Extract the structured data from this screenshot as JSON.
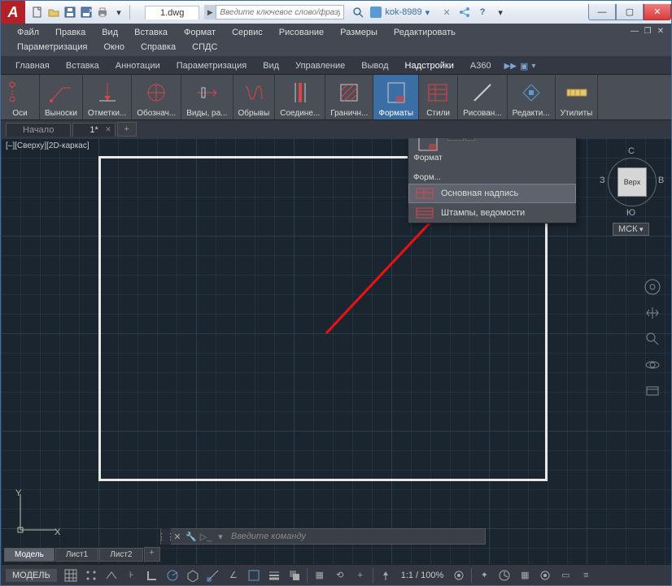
{
  "titlebar": {
    "app_initial": "A",
    "doc_title": "1.dwg",
    "search_placeholder": "Введите ключевое слово/фразу",
    "signin_user": "kok-8989"
  },
  "menu": {
    "items": [
      "Файл",
      "Правка",
      "Вид",
      "Вставка",
      "Формат",
      "Сервис",
      "Рисование",
      "Размеры",
      "Редактировать",
      "Параметризация",
      "Окно",
      "Справка",
      "СПДС"
    ]
  },
  "ribbon_tabs": [
    "Главная",
    "Вставка",
    "Аннотации",
    "Параметризация",
    "Вид",
    "Управление",
    "Вывод",
    "Надстройки",
    "A360"
  ],
  "ribbon_panels": [
    {
      "label": "Оси",
      "icon": "axes"
    },
    {
      "label": "Выноски",
      "icon": "leader"
    },
    {
      "label": "Отметки...",
      "icon": "marks"
    },
    {
      "label": "Обознач...",
      "icon": "symbol"
    },
    {
      "label": "Виды, ра...",
      "icon": "views"
    },
    {
      "label": "Обрывы",
      "icon": "breaks"
    },
    {
      "label": "Соедине...",
      "icon": "joins"
    },
    {
      "label": "Граничн...",
      "icon": "hatch"
    },
    {
      "label": "Форматы",
      "icon": "format",
      "active": true
    },
    {
      "label": "Стили",
      "icon": "styles"
    },
    {
      "label": "Рисован...",
      "icon": "draw"
    },
    {
      "label": "Редакти...",
      "icon": "edit"
    },
    {
      "label": "Утилиты",
      "icon": "utils"
    }
  ],
  "file_tabs": {
    "start": "Начало",
    "active": "1*"
  },
  "view_label": "[–][Сверху][2D-каркас]",
  "dropdown": {
    "format_label": "Формат",
    "forms_label": "Форм...",
    "item1": "Основная надпись",
    "item2": "Штампы, ведомости"
  },
  "viewcube": {
    "top": "Верх",
    "n": "С",
    "s": "Ю",
    "e": "В",
    "w": "З",
    "wcs": "МСК"
  },
  "layout_tabs": {
    "model": "Модель",
    "sheet1": "Лист1",
    "sheet2": "Лист2"
  },
  "cmd_placeholder": "Введите команду",
  "statusbar": {
    "model": "МОДЕЛЬ",
    "scale": "1:1 / 100%"
  }
}
